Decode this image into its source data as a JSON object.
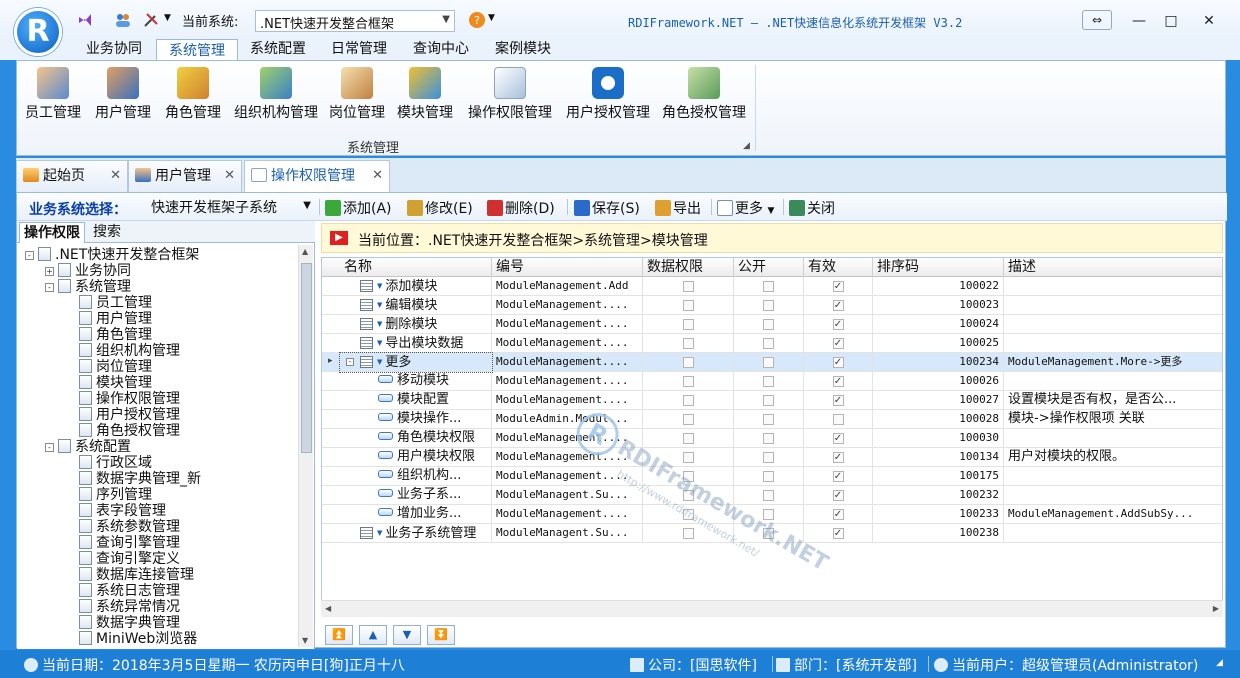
{
  "quickbar": {
    "system_label": "当前系统:",
    "system_value": ".NET快速开发整合框架"
  },
  "app_title": "RDIFramework.NET — .NET快速信息化系统开发框架 V3.2",
  "ribbon": {
    "tabs": [
      "业务协同",
      "系统管理",
      "系统配置",
      "日常管理",
      "查询中心",
      "案例模块"
    ],
    "active_tab": 1,
    "buttons": [
      "员工管理",
      "用户管理",
      "角色管理",
      "组织机构管理",
      "岗位管理",
      "模块管理",
      "操作权限管理",
      "用户授权管理",
      "角色授权管理"
    ],
    "group_label": "系统管理"
  },
  "doc_tabs": [
    "起始页",
    "用户管理",
    "操作权限管理"
  ],
  "toolbar": {
    "biz_label": "业务系统选择：",
    "biz_value": "快速开发框架子系统",
    "buttons": [
      "添加(A)",
      "修改(E)",
      "删除(D)",
      "保存(S)",
      "导出",
      "更多",
      "关闭"
    ]
  },
  "left_tabs": [
    "操作权限",
    "搜索"
  ],
  "tree": [
    {
      "label": ".NET快速开发整合框架",
      "level": 0,
      "exp": "-"
    },
    {
      "label": "业务协同",
      "level": 1,
      "exp": "+"
    },
    {
      "label": "系统管理",
      "level": 1,
      "exp": "-"
    },
    {
      "label": "员工管理",
      "level": 2,
      "exp": ""
    },
    {
      "label": "用户管理",
      "level": 2,
      "exp": ""
    },
    {
      "label": "角色管理",
      "level": 2,
      "exp": ""
    },
    {
      "label": "组织机构管理",
      "level": 2,
      "exp": ""
    },
    {
      "label": "岗位管理",
      "level": 2,
      "exp": ""
    },
    {
      "label": "模块管理",
      "level": 2,
      "exp": ""
    },
    {
      "label": "操作权限管理",
      "level": 2,
      "exp": ""
    },
    {
      "label": "用户授权管理",
      "level": 2,
      "exp": ""
    },
    {
      "label": "角色授权管理",
      "level": 2,
      "exp": ""
    },
    {
      "label": "系统配置",
      "level": 1,
      "exp": "-"
    },
    {
      "label": "行政区域",
      "level": 2,
      "exp": ""
    },
    {
      "label": "数据字典管理_新",
      "level": 2,
      "exp": ""
    },
    {
      "label": "序列管理",
      "level": 2,
      "exp": ""
    },
    {
      "label": "表字段管理",
      "level": 2,
      "exp": ""
    },
    {
      "label": "系统参数管理",
      "level": 2,
      "exp": ""
    },
    {
      "label": "查询引擎管理",
      "level": 2,
      "exp": ""
    },
    {
      "label": "查询引擎定义",
      "level": 2,
      "exp": ""
    },
    {
      "label": "数据库连接管理",
      "level": 2,
      "exp": ""
    },
    {
      "label": "系统日志管理",
      "level": 2,
      "exp": ""
    },
    {
      "label": "系统异常情况",
      "level": 2,
      "exp": ""
    },
    {
      "label": "数据字典管理",
      "level": 2,
      "exp": ""
    },
    {
      "label": "MiniWeb浏览器",
      "level": 2,
      "exp": ""
    }
  ],
  "location": "当前位置：.NET快速开发整合框架>系统管理>模块管理",
  "grid": {
    "columns": [
      "名称",
      "编号",
      "数据权限",
      "公开",
      "有效",
      "排序码",
      "描述"
    ],
    "rows": [
      {
        "name": "添加模块",
        "code": "ModuleManagement.Add",
        "data": false,
        "public": false,
        "valid": true,
        "sort": "100022",
        "desc": "",
        "level": 0,
        "icon": "m"
      },
      {
        "name": "编辑模块",
        "code": "ModuleManagement....",
        "data": false,
        "public": false,
        "valid": true,
        "sort": "100023",
        "desc": "",
        "level": 0,
        "icon": "m"
      },
      {
        "name": "删除模块",
        "code": "ModuleManagement....",
        "data": false,
        "public": false,
        "valid": true,
        "sort": "100024",
        "desc": "",
        "level": 0,
        "icon": "m"
      },
      {
        "name": "导出模块数据",
        "code": "ModuleManagement....",
        "data": false,
        "public": false,
        "valid": true,
        "sort": "100025",
        "desc": "",
        "level": 0,
        "icon": "m"
      },
      {
        "name": "更多",
        "code": "ModuleManagement....",
        "data": false,
        "public": false,
        "valid": true,
        "sort": "100234",
        "desc": "ModuleManagement.More->更多",
        "level": 0,
        "icon": "m",
        "selected": true
      },
      {
        "name": "移动模块",
        "code": "ModuleManagement....",
        "data": false,
        "public": false,
        "valid": true,
        "sort": "100026",
        "desc": "",
        "level": 1,
        "icon": "l"
      },
      {
        "name": "模块配置",
        "code": "ModuleManagement....",
        "data": false,
        "public": false,
        "valid": true,
        "sort": "100027",
        "desc": "设置模块是否有权，是否公...",
        "level": 1,
        "icon": "l"
      },
      {
        "name": "模块操作...",
        "code": "ModuleAdmin.Modul...",
        "data": false,
        "public": false,
        "valid": false,
        "sort": "100028",
        "desc": "模块->操作权限项 关联",
        "level": 1,
        "icon": "l"
      },
      {
        "name": "角色模块权限",
        "code": "ModuleManagement....",
        "data": false,
        "public": false,
        "valid": true,
        "sort": "100030",
        "desc": "",
        "level": 1,
        "icon": "l"
      },
      {
        "name": "用户模块权限",
        "code": "ModuleManagement....",
        "data": false,
        "public": false,
        "valid": true,
        "sort": "100134",
        "desc": "用户对模块的权限。",
        "level": 1,
        "icon": "l"
      },
      {
        "name": "组织机构...",
        "code": "ModuleManagement....",
        "data": false,
        "public": false,
        "valid": true,
        "sort": "100175",
        "desc": "",
        "level": 1,
        "icon": "l"
      },
      {
        "name": "业务子系...",
        "code": "ModuleManagent.Su...",
        "data": false,
        "public": false,
        "valid": true,
        "sort": "100232",
        "desc": "",
        "level": 1,
        "icon": "l"
      },
      {
        "name": "增加业务...",
        "code": "ModuleManagement....",
        "data": false,
        "public": false,
        "valid": true,
        "sort": "100233",
        "desc": "ModuleManagement.AddSubSy...",
        "level": 1,
        "icon": "l"
      },
      {
        "name": "业务子系统管理",
        "code": "ModuleManagent.Su...",
        "data": false,
        "public": false,
        "valid": true,
        "sort": "100238",
        "desc": "",
        "level": 0,
        "icon": "m"
      }
    ]
  },
  "watermark": {
    "brand": "RDIFramework.NET",
    "url": "http://www.rdiframework.net/"
  },
  "statusbar": {
    "date": "当前日期：2018年3月5日星期一 农历丙申日[狗]正月十八",
    "company": "公司：[国思软件]",
    "dept": "部门：[系统开发部]",
    "user": "当前用户：超级管理员(Administrator)"
  },
  "colors": {
    "accent": "#1a5fb4",
    "statusbar": "#1e7fd6",
    "selected_row": "#d7e8fb"
  }
}
